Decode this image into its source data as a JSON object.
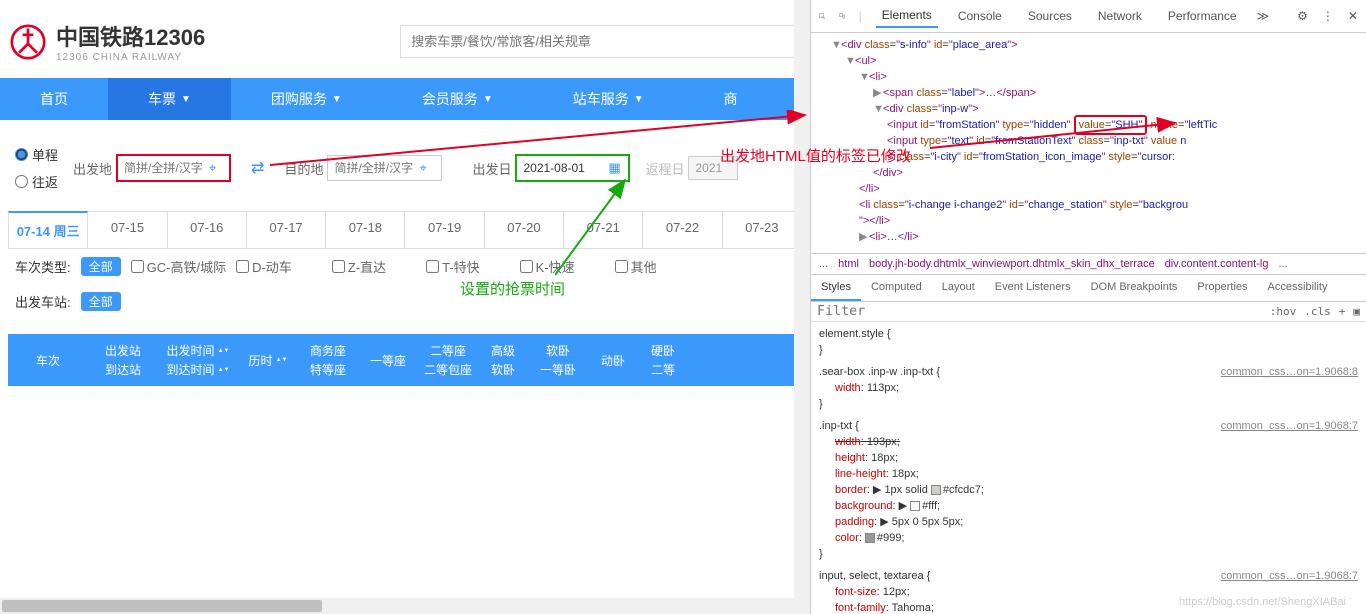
{
  "header": {
    "title": "中国铁路12306",
    "subtitle": "12306 CHINA RAILWAY",
    "search_placeholder": "搜索车票/餐饮/常旅客/相关规章"
  },
  "nav": {
    "items": [
      "首页",
      "车票",
      "团购服务",
      "会员服务",
      "站车服务",
      "商"
    ]
  },
  "trip": {
    "oneway": "单程",
    "roundtrip": "往返"
  },
  "form": {
    "from_label": "出发地",
    "from_placeholder": "简拼/全拼/汉字",
    "to_label": "目的地",
    "to_placeholder": "简拼/全拼/汉字",
    "depart_label": "出发日",
    "depart_value": "2021-08-01",
    "return_label": "返程日",
    "return_value": "2021"
  },
  "dates": {
    "active": "07-14 周三",
    "tabs": [
      "07-15",
      "07-16",
      "07-17",
      "07-18",
      "07-19",
      "07-20",
      "07-21",
      "07-22",
      "07-23"
    ]
  },
  "filters": {
    "type_label": "车次类型:",
    "station_label": "出发车站:",
    "all": "全部",
    "types": [
      "GC-高铁/城际",
      "D-动车",
      "Z-直达",
      "T-特快",
      "K-快速",
      "其他"
    ]
  },
  "table_headers": {
    "col1": "车次",
    "col2a": "出发站",
    "col2b": "到达站",
    "col3a": "出发时间",
    "col3b": "到达时间",
    "col4": "历时",
    "col5a": "商务座",
    "col5b": "特等座",
    "col6": "一等座",
    "col7a": "二等座",
    "col7b": "二等包座",
    "col8a": "高级",
    "col8b": "软卧",
    "col9a": "软卧",
    "col9b": "一等卧",
    "col10": "动卧",
    "col11a": "硬卧",
    "col11b": "二等"
  },
  "annotations": {
    "red_text": "出发地HTML值的标签已修改",
    "green_text": "设置的抢票时间"
  },
  "devtools": {
    "tabs": [
      "Elements",
      "Console",
      "Sources",
      "Network",
      "Performance"
    ],
    "breadcrumbs": [
      "...",
      "html",
      "body.jh-body.dhtmlx_winviewport.dhtmlx_skin_dhx_terrace",
      "div.content.content-lg",
      "..."
    ],
    "style_tabs": [
      "Styles",
      "Computed",
      "Layout",
      "Event Listeners",
      "DOM Breakpoints",
      "Properties",
      "Accessibility"
    ],
    "filter_placeholder": "Filter",
    "hov": ":hov",
    "cls": ".cls",
    "tree": {
      "l1": "div",
      "l1_class": "s-info",
      "l1_id": "place_area",
      "l2": "ul",
      "l3": "li",
      "l4": "span",
      "l4_class": "label",
      "l5": "div",
      "l5_class": "inp-w",
      "l6_id": "fromStation",
      "l6_type": "hidden",
      "l6_value": "SHH",
      "l6_name": "leftTic",
      "l7_type": "text",
      "l7_id": "fromStationText",
      "l7_class": "inp-txt",
      "l7_value": "n",
      "l8_class": "i-city",
      "l8_id": "fromStation_icon_image",
      "l8_style": "cursor:",
      "l9_close": "div",
      "l10_close": "li",
      "l11": "li",
      "l11_class": "i-change i-change2",
      "l11_id": "change_station",
      "l11_style": "backgrou",
      "l12": "li"
    },
    "styles": {
      "r0_sel": "element.style",
      "r1_sel": ".sear-box .inp-w .inp-txt",
      "r1_link": "common_css…on=1.9068:8",
      "r1_p1": "width",
      "r1_v1": "113px",
      "r2_sel": ".inp-txt",
      "r2_link": "common_css…on=1.9068:7",
      "r2_p1": "width",
      "r2_v1": "193px",
      "r2_p2": "height",
      "r2_v2": "18px",
      "r2_p3": "line-height",
      "r2_v3": "18px",
      "r2_p4": "border",
      "r2_v4": "1px solid",
      "r2_c4": "#cfcdc7",
      "r2_p5": "background",
      "r2_c5": "#fff",
      "r2_p6": "padding",
      "r2_v6": "5px 0 5px 5px",
      "r2_p7": "color",
      "r2_c7": "#999",
      "r3_sel": "input, select, textarea",
      "r3_link": "common_css…on=1.9068:7",
      "r3_p1": "font-size",
      "r3_v1": "12px",
      "r3_p2": "font-family",
      "r3_v2": "Tahoma"
    }
  },
  "watermark": "https://blog.csdn.net/ShengXIABai"
}
